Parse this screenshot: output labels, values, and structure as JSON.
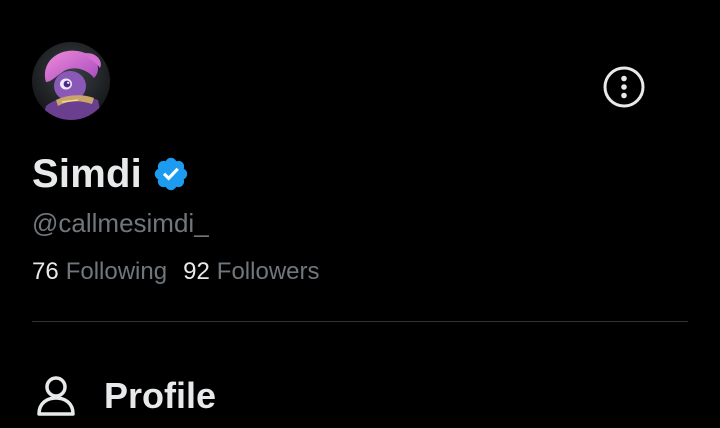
{
  "profile": {
    "display_name": "Simdi",
    "handle": "@callmesimdi_",
    "verified": true,
    "avatar_icon": "avatar-image"
  },
  "stats": {
    "following_count": "76",
    "following_label": "Following",
    "followers_count": "92",
    "followers_label": "Followers"
  },
  "menu": {
    "more_icon": "more-options-icon"
  },
  "nav": {
    "items": [
      {
        "label": "Profile",
        "icon": "person-icon"
      }
    ]
  },
  "colors": {
    "background": "#000000",
    "primary_text": "#e7e9ea",
    "secondary_text": "#71767b",
    "verified_badge": "#1d9bf0",
    "divider": "#2f3336"
  }
}
